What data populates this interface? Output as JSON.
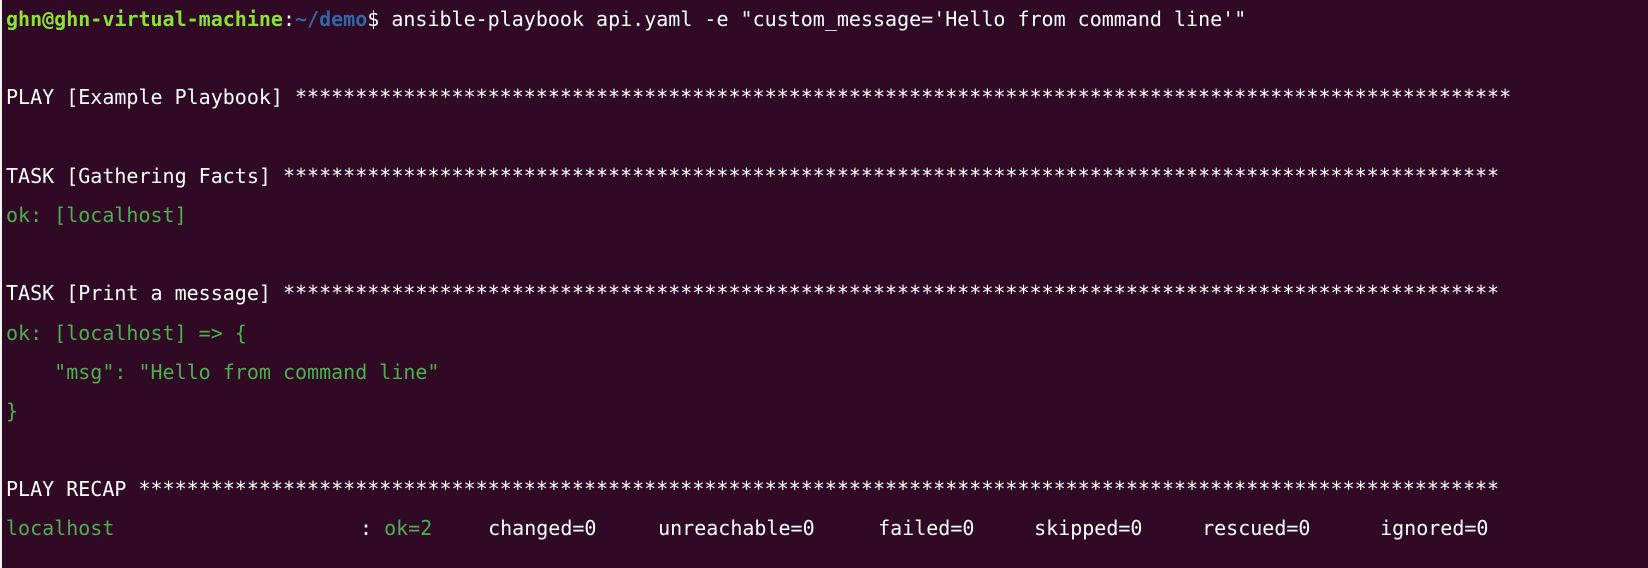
{
  "terminal": {
    "prompt": {
      "user_host": "ghn@ghn-virtual-machine",
      "colon": ":",
      "path": "~/demo",
      "dollar": "$ ",
      "command": "ansible-playbook api.yaml -e \"custom_message='Hello from command line'\""
    },
    "play_header": {
      "label": "PLAY [Example Playbook] ",
      "stars": "*****************************************************************************************************"
    },
    "task1": {
      "label": "TASK [Gathering Facts] ",
      "stars": "*****************************************************************************************************",
      "result": "ok: [localhost]"
    },
    "task2": {
      "label": "TASK [Print a message] ",
      "stars": "*****************************************************************************************************",
      "result_open": "ok: [localhost] => {",
      "msg_line": "    \"msg\": \"Hello from command line\"",
      "result_close": "}"
    },
    "recap": {
      "label": "PLAY RECAP ",
      "stars": "*****************************************************************************************************************",
      "host": "localhost",
      "colon": ": ",
      "ok": "ok=2",
      "changed": "changed=0",
      "unreachable": "unreachable=0",
      "failed": "failed=0",
      "skipped": "skipped=0",
      "rescued": "rescued=0",
      "ignored": "ignored=0"
    }
  },
  "colors": {
    "background": "#300a24",
    "ok_green": "#4caf50",
    "prompt_user": "#8ae234",
    "prompt_path": "#3465a4",
    "text": "#ffffff"
  }
}
